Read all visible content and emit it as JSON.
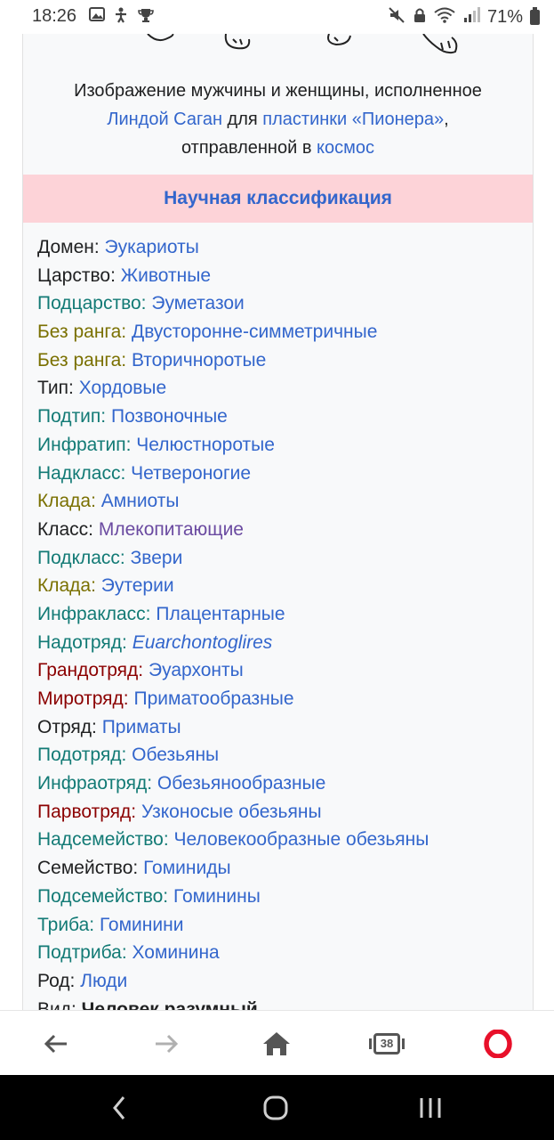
{
  "status_bar": {
    "time": "18:26",
    "left_icons": [
      "gallery-icon",
      "accessibility-icon",
      "trophy-icon"
    ],
    "right_icons": [
      "mute-icon",
      "lock-icon",
      "wifi-icon",
      "signal-icon"
    ],
    "battery": "71%"
  },
  "caption": {
    "line1": "Изображение мужчины и женщины, исполненное",
    "author_link": "Линдой Саган",
    "for_text": " для ",
    "record_link": "пластинки «Пионера»",
    "comma": ",",
    "sent_text": "отправленной в ",
    "space_link": "космос"
  },
  "classification_header": "Научная классификация",
  "taxonomy": [
    {
      "rank": "Домен:",
      "value": "Эукариоты"
    },
    {
      "rank": "Царство:",
      "value": "Животные"
    },
    {
      "rank": "Подцарство:",
      "value": "Эуметазои"
    },
    {
      "rank": "Без ранга:",
      "value": "Двусторонне-симметричные"
    },
    {
      "rank": "Без ранга:",
      "value": "Вторичноротые"
    },
    {
      "rank": "Тип:",
      "value": "Хордовые"
    },
    {
      "rank": "Подтип:",
      "value": "Позвоночные"
    },
    {
      "rank": "Инфратип:",
      "value": "Челюстноротые"
    },
    {
      "rank": "Надкласс:",
      "value": "Четвероногие"
    },
    {
      "rank": "Клада:",
      "value": "Амниоты"
    },
    {
      "rank": "Класс:",
      "value": "Млекопитающие"
    },
    {
      "rank": "Подкласс:",
      "value": "Звери"
    },
    {
      "rank": "Клада:",
      "value": "Эутерии"
    },
    {
      "rank": "Инфракласс:",
      "value": "Плацентарные"
    },
    {
      "rank": "Надотряд:",
      "value": "Euarchontoglires"
    },
    {
      "rank": "Грандотряд:",
      "value": "Эуархонты"
    },
    {
      "rank": "Миротряд:",
      "value": "Приматообразные"
    },
    {
      "rank": "Отряд:",
      "value": "Приматы"
    },
    {
      "rank": "Подотряд:",
      "value": "Обезьяны"
    },
    {
      "rank": "Инфраотряд:",
      "value": "Обезьянообразные"
    },
    {
      "rank": "Парвотряд:",
      "value": "Узконосые обезьяны"
    },
    {
      "rank": "Надсемейство:",
      "value": "Человекообразные обезьяны"
    },
    {
      "rank": "Семейство:",
      "value": "Гоминиды"
    },
    {
      "rank": "Подсемейство:",
      "value": "Гоминины"
    },
    {
      "rank": "Триба:",
      "value": "Гоминини"
    },
    {
      "rank": "Подтриба:",
      "value": "Хоминина"
    },
    {
      "rank": "Род:",
      "value": "Люди"
    },
    {
      "rank": "Вид:",
      "value": "Человек разумный"
    }
  ],
  "toolbar": {
    "back_icon": "back-arrow-icon",
    "forward_icon": "forward-arrow-icon",
    "home_icon": "home-icon",
    "tabs_count": "38",
    "menu_icon": "opera-logo-icon"
  },
  "navbar": {
    "back": "nav-back-icon",
    "home": "nav-home-icon",
    "recents": "nav-recents-icon"
  },
  "colors": {
    "link": "#3366cc",
    "visited_link": "#6b4ba1",
    "header_bg": "#fdd3d8",
    "rank_teal": "#127a75",
    "rank_olive": "#7a7000",
    "rank_darkred": "#8b0000",
    "opera_red": "#e8102a"
  }
}
